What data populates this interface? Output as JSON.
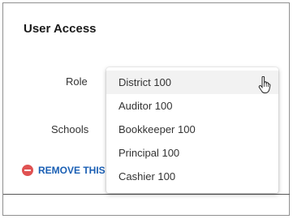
{
  "section": {
    "title": "User Access"
  },
  "fields": {
    "role_label": "Role",
    "schools_label": "Schools"
  },
  "remove": {
    "label": "REMOVE THIS I",
    "icon": "minus-circle-icon",
    "color": "#e05252",
    "link_color": "#1a5fb4"
  },
  "dropdown": {
    "options": [
      "District 100",
      "Auditor 100",
      "Bookkeeper 100",
      "Principal 100",
      "Cashier 100"
    ],
    "highlighted_index": 0
  },
  "cursor": {
    "icon": "hand-pointer-icon"
  }
}
